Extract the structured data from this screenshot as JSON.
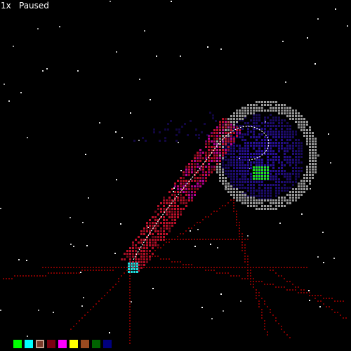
{
  "hud": {
    "speed": "1x",
    "status": "Paused"
  },
  "palette": {
    "selected_index": 2,
    "colors": [
      {
        "name": "green",
        "hex": "#00ff00"
      },
      {
        "name": "cyan",
        "hex": "#00ffff"
      },
      {
        "name": "brown-selected",
        "hex": "#7a3a2a"
      },
      {
        "name": "dark-red",
        "hex": "#7a0010"
      },
      {
        "name": "magenta",
        "hex": "#ff00ff"
      },
      {
        "name": "yellow",
        "hex": "#ffff00"
      },
      {
        "name": "sienna",
        "hex": "#9a4a20"
      },
      {
        "name": "dark-green",
        "hex": "#006400"
      },
      {
        "name": "navy",
        "hex": "#000080"
      }
    ]
  },
  "scene": {
    "colors": {
      "background": "#000000",
      "ring": "#9a9a9a",
      "vortex": "#2a10a0",
      "trail_red": "#c0102a",
      "trail_magenta": "#c000a0",
      "core_green": "#20e020",
      "core_cyan": "#20e0e0",
      "web_red": "#8a0000",
      "star": "#ffffff"
    }
  }
}
